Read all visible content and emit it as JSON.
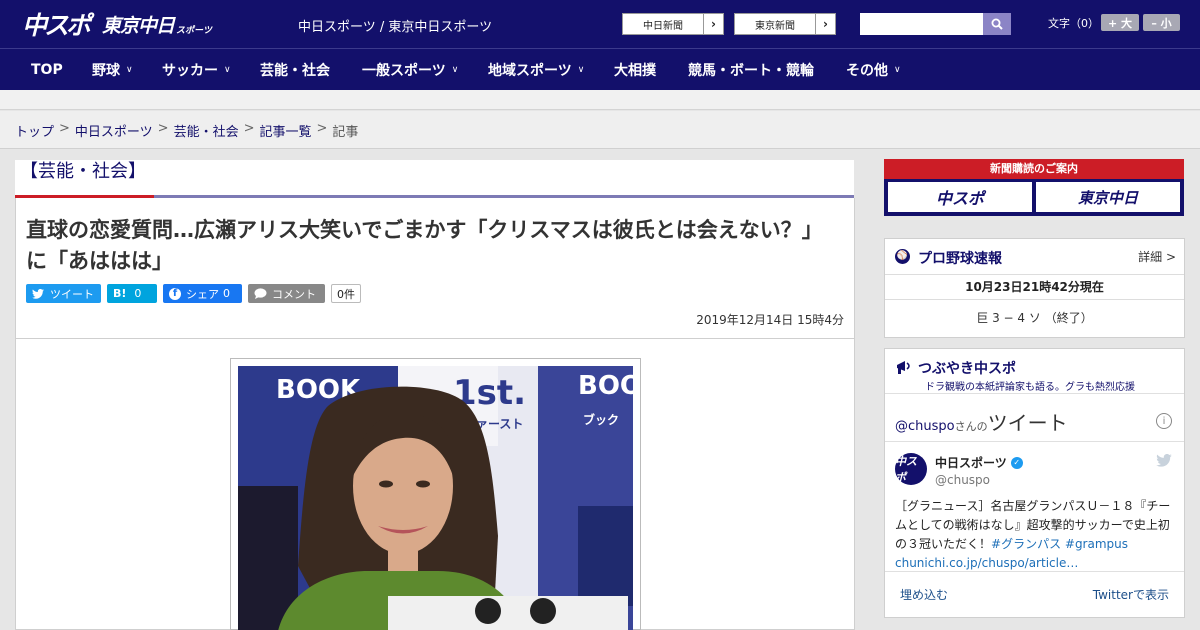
{
  "header": {
    "logo_chuspo": "中スポ",
    "logo_tokyo": "東京中日",
    "logo_sports": "スポーツ",
    "site_name": "中日スポーツ / 東京中日スポーツ",
    "paper_links": [
      "中日新聞",
      "東京新聞"
    ],
    "search_placeholder": "",
    "font_size_label": "文字（0）",
    "font_bigger": "+ 大",
    "font_smaller": "– 小"
  },
  "nav": {
    "items": [
      {
        "label": "TOP",
        "has_menu": false
      },
      {
        "label": "野球",
        "has_menu": true
      },
      {
        "label": "サッカー",
        "has_menu": true
      },
      {
        "label": "芸能・社会",
        "has_menu": false
      },
      {
        "label": "一般スポーツ",
        "has_menu": true
      },
      {
        "label": "地域スポーツ",
        "has_menu": true
      },
      {
        "label": "大相撲",
        "has_menu": false
      },
      {
        "label": "競馬・ボート・競輪",
        "has_menu": false
      },
      {
        "label": "その他",
        "has_menu": true
      }
    ]
  },
  "breadcrumb": [
    "トップ",
    "中日スポーツ",
    "芸能・社会",
    "記事一覧",
    "記事"
  ],
  "category_title": "【芸能・社会】",
  "article": {
    "headline": "直球の恋愛質問…広瀬アリス大笑いでごまかす「クリスマスは彼氏とは会えない？」に「あははは」",
    "share": {
      "tweet": "ツイート",
      "hatena": "B!",
      "hatena_count": "0",
      "facebook": "シェア",
      "facebook_count": "0",
      "comment": "コメント",
      "comment_count": "0件"
    },
    "date": "2019年12月14日 15時4分",
    "photo_backdrop_text": [
      "BOOK",
      "1st.",
      "ブックファースト",
      "BOO",
      "ブック"
    ]
  },
  "sidebar": {
    "promo": {
      "header": "新聞購読のご案内",
      "left": "中スポ",
      "right": "東京中日"
    },
    "baseball": {
      "title": "プロ野球速報",
      "more": "詳細 >",
      "time": "10月23日21時42分現在",
      "score": "巨 3 − 4 ソ （終了）"
    },
    "tweets": {
      "title": "つぶやき中スポ",
      "subtitle": "ドラ観戦の本紙評論家も語る。グラも熱烈応援",
      "handle": "@chuspo",
      "handle_suffix": "さんの",
      "heading": "ツイート",
      "name": "中日スポーツ",
      "username": "@chuspo",
      "avatar_text": "中スポ",
      "text": "［グラニュース］名古屋グランパスＵ－１８『チームとしての戦術はなし』超攻撃的サッカーで史上初の３冠いただく！",
      "hashtags": "#グランパス #grampus",
      "link": "chunichi.co.jp/chuspo/article…",
      "embed": "埋め込む",
      "view": "Twitterで表示"
    }
  },
  "colors": {
    "navy": "#13106b",
    "red": "#cc1d26",
    "twitter": "#1d9bf0",
    "facebook": "#1877f2",
    "hatena": "#00a4de"
  }
}
